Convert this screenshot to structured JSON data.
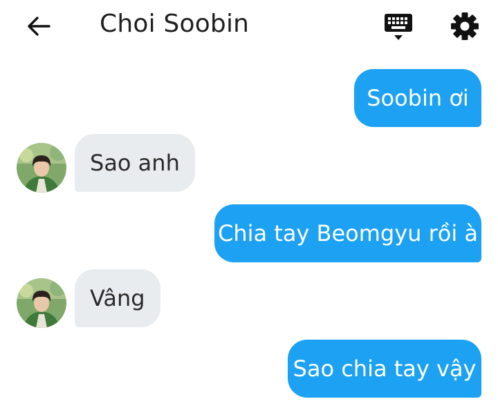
{
  "header": {
    "title": "Choi Soobin",
    "back_icon": "arrow-left-icon",
    "keyboard_icon": "keyboard-icon",
    "settings_icon": "gear-icon"
  },
  "messages": [
    {
      "from": "me",
      "text": "Soobin ơi"
    },
    {
      "from": "other",
      "text": "Sao anh",
      "avatar": "avatar"
    },
    {
      "from": "me",
      "text": "Chia tay Beomgyu rồi à"
    },
    {
      "from": "other",
      "text": "Vâng",
      "avatar": "avatar"
    },
    {
      "from": "me",
      "text": "Sao chia tay vậy"
    }
  ],
  "colors": {
    "outgoing_bubble": "#1da1f2",
    "incoming_bubble": "#e9ecef",
    "title_text": "#1f1f1f"
  }
}
